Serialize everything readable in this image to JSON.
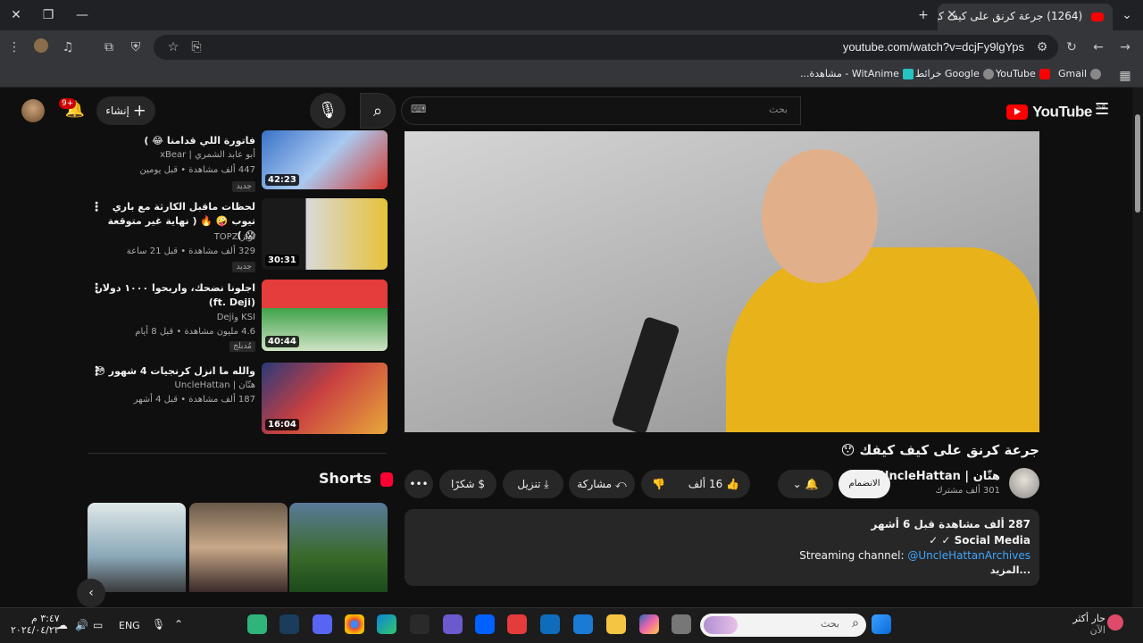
{
  "browser": {
    "tab_title": "(1264) جرعة كرنق على كيف كيفك",
    "url": "youtube.com/watch?v=dcjFy9lgYps",
    "bookmarks": [
      "Gmail",
      "YouTube",
      "Google خرائط",
      "WitAnime - مشاهدة..."
    ]
  },
  "youtube": {
    "logo": "YouTube",
    "region": "SA",
    "search_placeholder": "بحث",
    "create_label": "إنشاء",
    "notif_count": "9+"
  },
  "related": [
    {
      "title": "فاتورة اللي قدامنا 😂 )",
      "channel": "أبو عابد الشمري | xBear",
      "meta": "447 ألف مشاهدة • قبل يومين",
      "badge": "جديد",
      "duration": "42:23"
    },
    {
      "title": "لحظات ماقبل الكارثة مع باري تيوب 🤪 🔥 ( نهاية غير متوقعة 😱 )",
      "channel": "توبز TOPZ",
      "meta": "329 ألف مشاهدة • قبل 21 ساعة",
      "badge": "جديد",
      "duration": "30:31"
    },
    {
      "title": "اجلونا نضحك، واربحوا ١٠٠٠ دولار (ft. Deji)",
      "channel": "KSI وDeji",
      "meta": "4.6 مليون مشاهدة • قبل 8 أيام",
      "badge": "مُدبلج",
      "duration": "40:44"
    },
    {
      "title": "والله ما انزل كرنجيات 4 شهور 😳",
      "channel": "هتّان | UncleHattan",
      "meta": "187 ألف مشاهدة • قبل 4 أشهر",
      "badge": "",
      "duration": "16:04"
    }
  ],
  "shorts_label": "Shorts",
  "video": {
    "title": "جرعة كرنق على كيف كيفك 😯",
    "channel": "هتّان | UncleHattan",
    "subs": "301 ألف مشترك",
    "subscribe": "الانضمام",
    "likes": "16 ألف",
    "share": "مشاركة",
    "download": "تنزيل",
    "thanks": "شكرًا",
    "views_line": "287 ألف مشاهدة  قبل 6 أشهر",
    "desc1": "Social Media ✓ ✓",
    "desc2_label": "Streaming channel:",
    "desc2_link": "@UncleHattanArchives",
    "more": "...المزيد"
  },
  "taskbar": {
    "search_placeholder": "بحث",
    "lang": "ENG",
    "time": "٣:٤٧ م",
    "date": "٢٠٢٤/٠٤/٢٣",
    "weather": "حار أكثر",
    "weather_sub": "الآن"
  },
  "colors": {
    "accent_red": "#ff0000",
    "link_blue": "#3ea6ff"
  }
}
